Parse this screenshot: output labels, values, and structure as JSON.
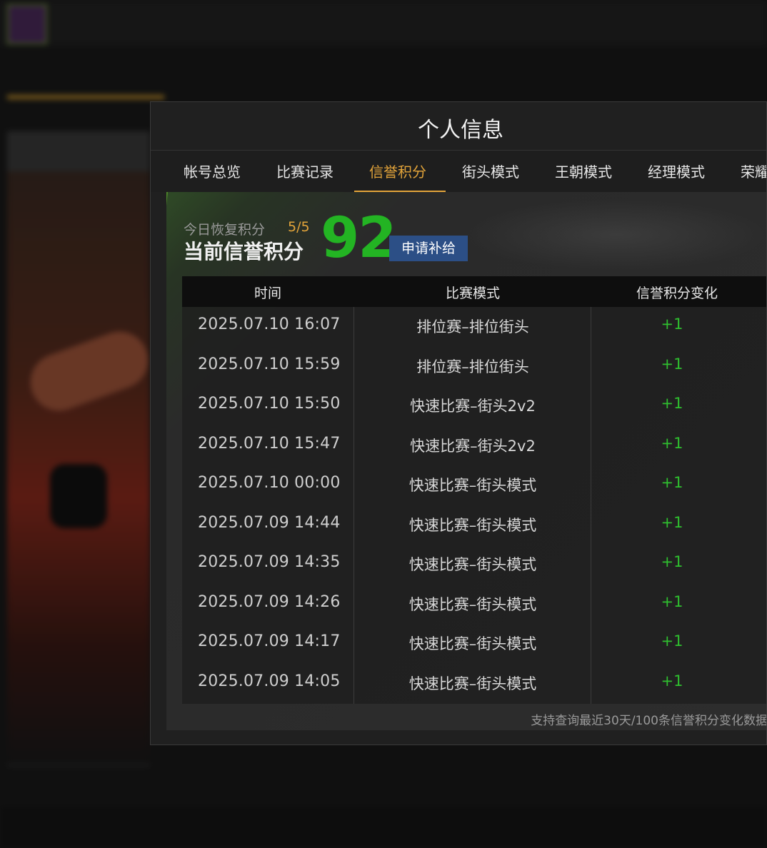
{
  "modal": {
    "title": "个人信息",
    "tabs": [
      {
        "label": "帐号总览"
      },
      {
        "label": "比赛记录"
      },
      {
        "label": "信誉积分"
      },
      {
        "label": "街头模式"
      },
      {
        "label": "王朝模式"
      },
      {
        "label": "经理模式"
      },
      {
        "label": "荣耀"
      }
    ],
    "active_tab": "信誉积分"
  },
  "credit": {
    "recover_label": "今日恢复积分",
    "recover_value": "5/5",
    "current_label": "当前信誉积分",
    "current_value": "92",
    "apply_button": "申请补给"
  },
  "table": {
    "headers": [
      "时间",
      "比赛模式",
      "信誉积分变化"
    ],
    "rows": [
      {
        "time": "2025.07.10  16:07",
        "mode": "排位赛–排位街头",
        "change": "+1"
      },
      {
        "time": "2025.07.10  15:59",
        "mode": "排位赛–排位街头",
        "change": "+1"
      },
      {
        "time": "2025.07.10  15:50",
        "mode": "快速比赛–街头2v2",
        "change": "+1"
      },
      {
        "time": "2025.07.10  15:47",
        "mode": "快速比赛–街头2v2",
        "change": "+1"
      },
      {
        "time": "2025.07.10  00:00",
        "mode": "快速比赛–街头模式",
        "change": "+1"
      },
      {
        "time": "2025.07.09  14:44",
        "mode": "快速比赛–街头模式",
        "change": "+1"
      },
      {
        "time": "2025.07.09  14:35",
        "mode": "快速比赛–街头模式",
        "change": "+1"
      },
      {
        "time": "2025.07.09  14:26",
        "mode": "快速比赛–街头模式",
        "change": "+1"
      },
      {
        "time": "2025.07.09  14:17",
        "mode": "快速比赛–街头模式",
        "change": "+1"
      },
      {
        "time": "2025.07.09  14:05",
        "mode": "快速比赛–街头模式",
        "change": "+1"
      }
    ]
  },
  "footnote": "支持查询最近30天/100条信誉积分变化数据",
  "colors": {
    "accent": "#e3a43a",
    "positive": "#2fbf2f",
    "score": "#23b423",
    "button": "#2c4f86"
  }
}
